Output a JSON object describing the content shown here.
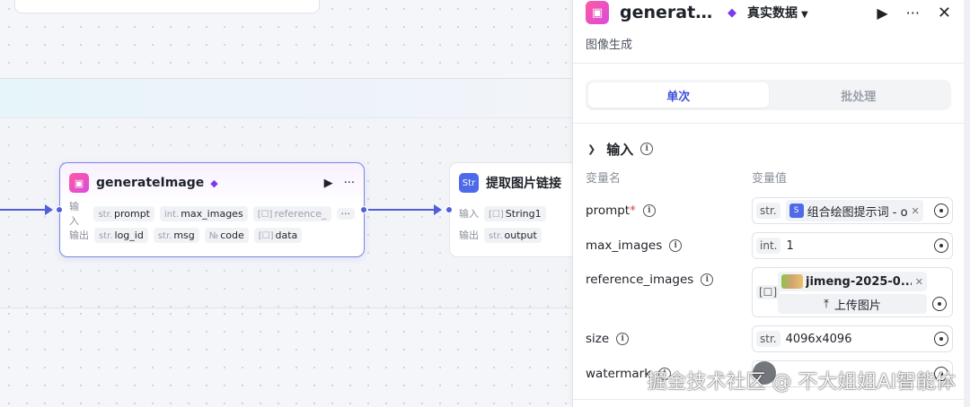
{
  "canvas": {
    "nodes": [
      {
        "title": "generateImage",
        "actions": [
          "▶",
          "···"
        ],
        "inputs_label": "输入",
        "outputs_label": "输出",
        "inputs": [
          {
            "type": "str.",
            "name": "prompt"
          },
          {
            "type": "int.",
            "name": "max_images"
          },
          {
            "type": "[☐]",
            "name": "reference_"
          }
        ],
        "inputs_more": "···",
        "outputs": [
          {
            "type": "str.",
            "name": "log_id"
          },
          {
            "type": "str.",
            "name": "msg"
          },
          {
            "type": "№",
            "name": "code"
          },
          {
            "type": "[☐]",
            "name": "data"
          }
        ]
      },
      {
        "title": "提取图片链接",
        "inputs_label": "输入",
        "outputs_label": "输出",
        "inputs": [
          {
            "type": "[☐]",
            "name": "String1"
          }
        ],
        "outputs": [
          {
            "type": "str.",
            "name": "output"
          }
        ]
      }
    ]
  },
  "panel": {
    "title": "generateIm...",
    "mode": "真实数据",
    "subtitle": "图像生成",
    "tabs": [
      {
        "label": "单次",
        "active": true
      },
      {
        "label": "批处理",
        "active": false
      }
    ],
    "section_title": "输入",
    "col_name": "变量名",
    "col_value": "变量值",
    "fields": {
      "prompt": {
        "name": "prompt",
        "required_mark": "*",
        "type": "str.",
        "ref": "组合绘图提示词 - o"
      },
      "max_images": {
        "name": "max_images",
        "type": "int.",
        "value": "1"
      },
      "reference_images": {
        "name": "reference_images",
        "type": "[☐]",
        "image_name": "jimeng-2025-0...",
        "upload_label": "上传图片"
      },
      "size": {
        "name": "size",
        "type": "str.",
        "value": "4096x4096"
      },
      "watermark": {
        "name": "watermark"
      }
    }
  },
  "watermark_text": "掘金技术社区 @ 不大姐姐AI智能体",
  "colors": {
    "accent": "#4e5fd8",
    "brand_pink": "#e24fbf",
    "gem": "#7c3aed"
  }
}
